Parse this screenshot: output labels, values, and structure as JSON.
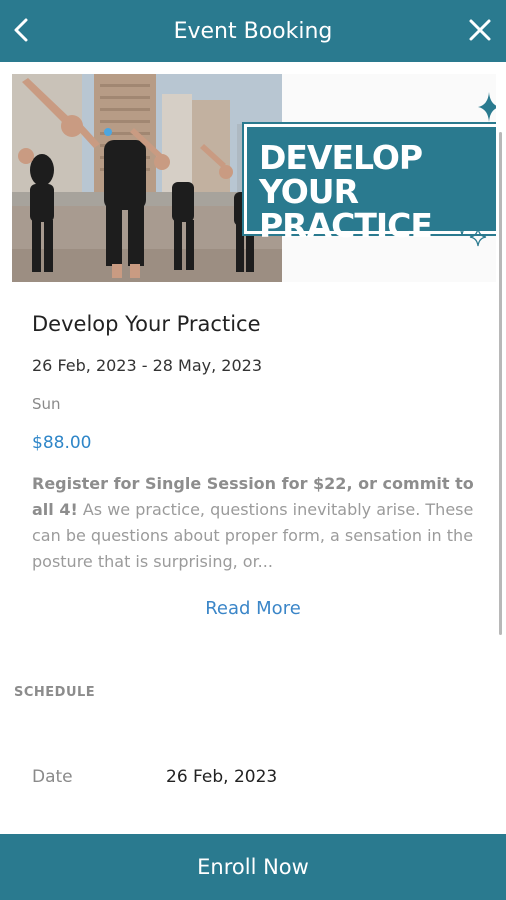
{
  "header": {
    "title": "Event Booking",
    "back_icon": "chevron-left-icon",
    "close_icon": "close-icon",
    "color": "#2a7a8f"
  },
  "event": {
    "banner_text": "DEVELOP YOUR\nPRACTICE",
    "title": "Develop Your Practice",
    "dates": "26 Feb, 2023 - 28 May, 2023",
    "days": "Sun",
    "price": "$88.00",
    "description_bold": "Register for Single Session for $22, or commit to all 4!",
    "description_rest": " As we practice, questions inevitably arise. These can be questions about proper form, a sensation in the posture that is surprising, or...",
    "read_more": "Read More"
  },
  "schedule": {
    "section_label": "SCHEDULE",
    "rows": [
      {
        "label": "Date",
        "value": "26 Feb, 2023"
      }
    ]
  },
  "footer": {
    "enroll_label": "Enroll Now"
  },
  "colors": {
    "accent": "#2a7a8f",
    "price": "#2f86c8",
    "link": "#3b86c8"
  }
}
